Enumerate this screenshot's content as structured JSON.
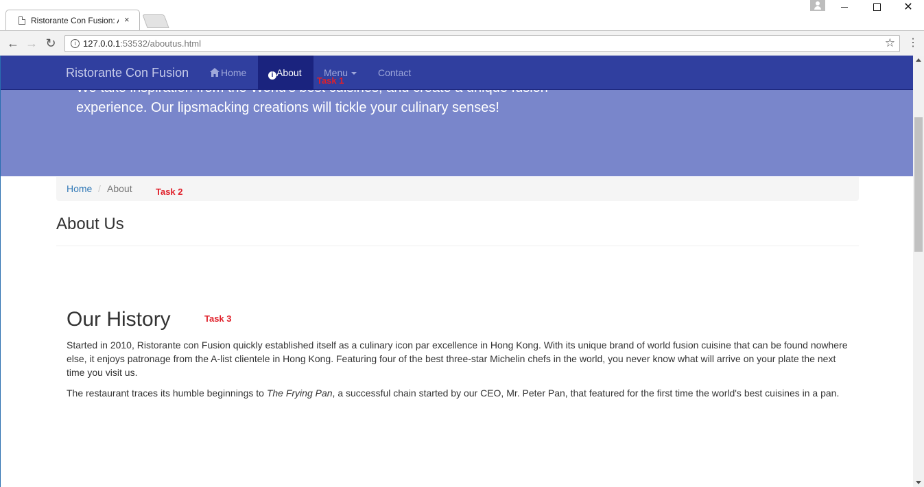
{
  "browser": {
    "tab_title": "Ristorante Con Fusion: About Us",
    "tab_close": "×",
    "url_host": "127.0.0.1",
    "url_rest": ":53532/aboutus.html",
    "icons": [
      "back-arrow-icon",
      "forward-arrow-icon",
      "reload-icon",
      "info-icon",
      "star-icon",
      "more-vert-icon",
      "profile-icon"
    ]
  },
  "navbar": {
    "brand": "Ristorante Con Fusion",
    "items": [
      {
        "label": "Home",
        "icon": "home-icon"
      },
      {
        "label": "About",
        "icon": "info-sign-icon",
        "active": true
      },
      {
        "label": "Menu",
        "icon": "caret-down-icon"
      },
      {
        "label": "Contact"
      }
    ]
  },
  "jumbotron": {
    "line1": "We take inspiration from the World's best cuisines, and create a unique fusion",
    "line2": "experience. Our lipsmacking creations will tickle your culinary senses!"
  },
  "breadcrumb": {
    "home": "Home",
    "separator": "/",
    "current": "About"
  },
  "page_title": "About Us",
  "history": {
    "heading": "Our History",
    "para1": "Started in 2010, Ristorante con Fusion quickly established itself as a culinary icon par excellence in Hong Kong. With its unique brand of world fusion cuisine that can be found nowhere else, it enjoys patronage from the A-list clientele in Hong Kong. Featuring four of the best three-star Michelin chefs in the world, you never know what will arrive on your plate the next time you visit us.",
    "para2_before": "The restaurant traces its humble beginnings to ",
    "para2_italic": "The Frying Pan",
    "para2_after": ", a successful chain started by our CEO, Mr. Peter Pan, that featured for the first time the world's best cuisines in a pan."
  },
  "annotations": {
    "task1": "Task 1",
    "task2": "Task 2",
    "task3": "Task 3"
  },
  "colors": {
    "navbar": "#303f9f",
    "navbar_active": "#1a237e",
    "jumbotron": "#7986cb",
    "annotation": "#e0202a",
    "link": "#337ab7"
  }
}
